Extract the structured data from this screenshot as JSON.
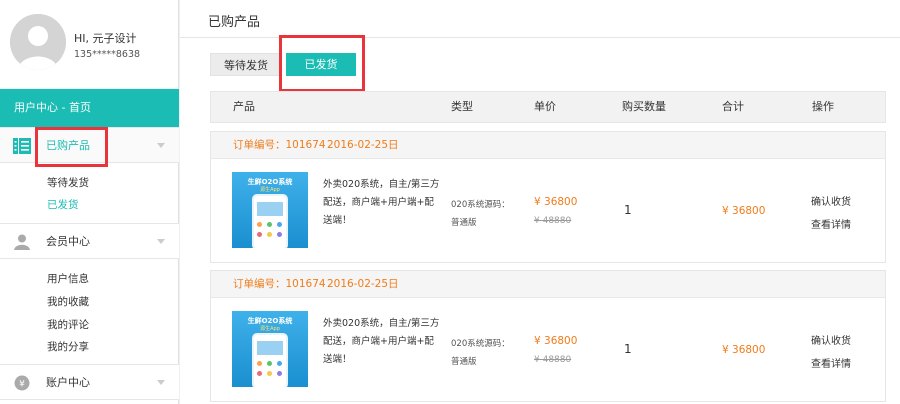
{
  "profile": {
    "greeting": "HI, 元子设计",
    "phone": "135*****8638"
  },
  "sidebar": {
    "home_label": "用户中心 - 首页",
    "products": {
      "label": "已购产品",
      "subitems": [
        "等待发货",
        "已发货"
      ]
    },
    "member": {
      "label": "会员中心",
      "subitems": [
        "用户信息",
        "我的收藏",
        "我的评论",
        "我的分享"
      ]
    },
    "account": {
      "label": "账户中心"
    }
  },
  "main": {
    "title": "已购产品",
    "tabs": [
      {
        "label": "等待发货",
        "active": false
      },
      {
        "label": "已发货",
        "active": true
      }
    ],
    "columns": [
      "产品",
      "类型",
      "单价",
      "购买数量",
      "合计",
      "操作"
    ],
    "orders": [
      {
        "order_label": "订单编号：101674",
        "date": "2016-02-25日",
        "image_title": "生鲜O2O系统",
        "image_subtitle": "源生App",
        "product_name": "外卖020系统，自主/第三方配送，商户端+用户端+配送端！",
        "type_line1": "020系统源码：",
        "type_line2": "普通版",
        "price": "¥ 36800",
        "original_price": "¥ 48880",
        "quantity": "1",
        "total": "¥ 36800",
        "action_confirm": "确认收货",
        "action_detail": "查看详情"
      },
      {
        "order_label": "订单编号：101674",
        "date": "2016-02-25日",
        "image_title": "生鲜O2O系统",
        "image_subtitle": "源生App",
        "product_name": "外卖020系统，自主/第三方配送，商户端+用户端+配送端！",
        "type_line1": "020系统源码：",
        "type_line2": "普通版",
        "price": "¥ 36800",
        "original_price": "¥ 48880",
        "quantity": "1",
        "total": "¥ 36800",
        "action_confirm": "确认收货",
        "action_detail": "查看详情"
      }
    ]
  },
  "colors": {
    "accent": "#1bbcb3",
    "price": "#f07c1a",
    "highlight": "#e8343a"
  },
  "icons": [
    "avatar-icon",
    "product-list-icon",
    "member-icon",
    "account-icon",
    "chevron-down-icon"
  ]
}
